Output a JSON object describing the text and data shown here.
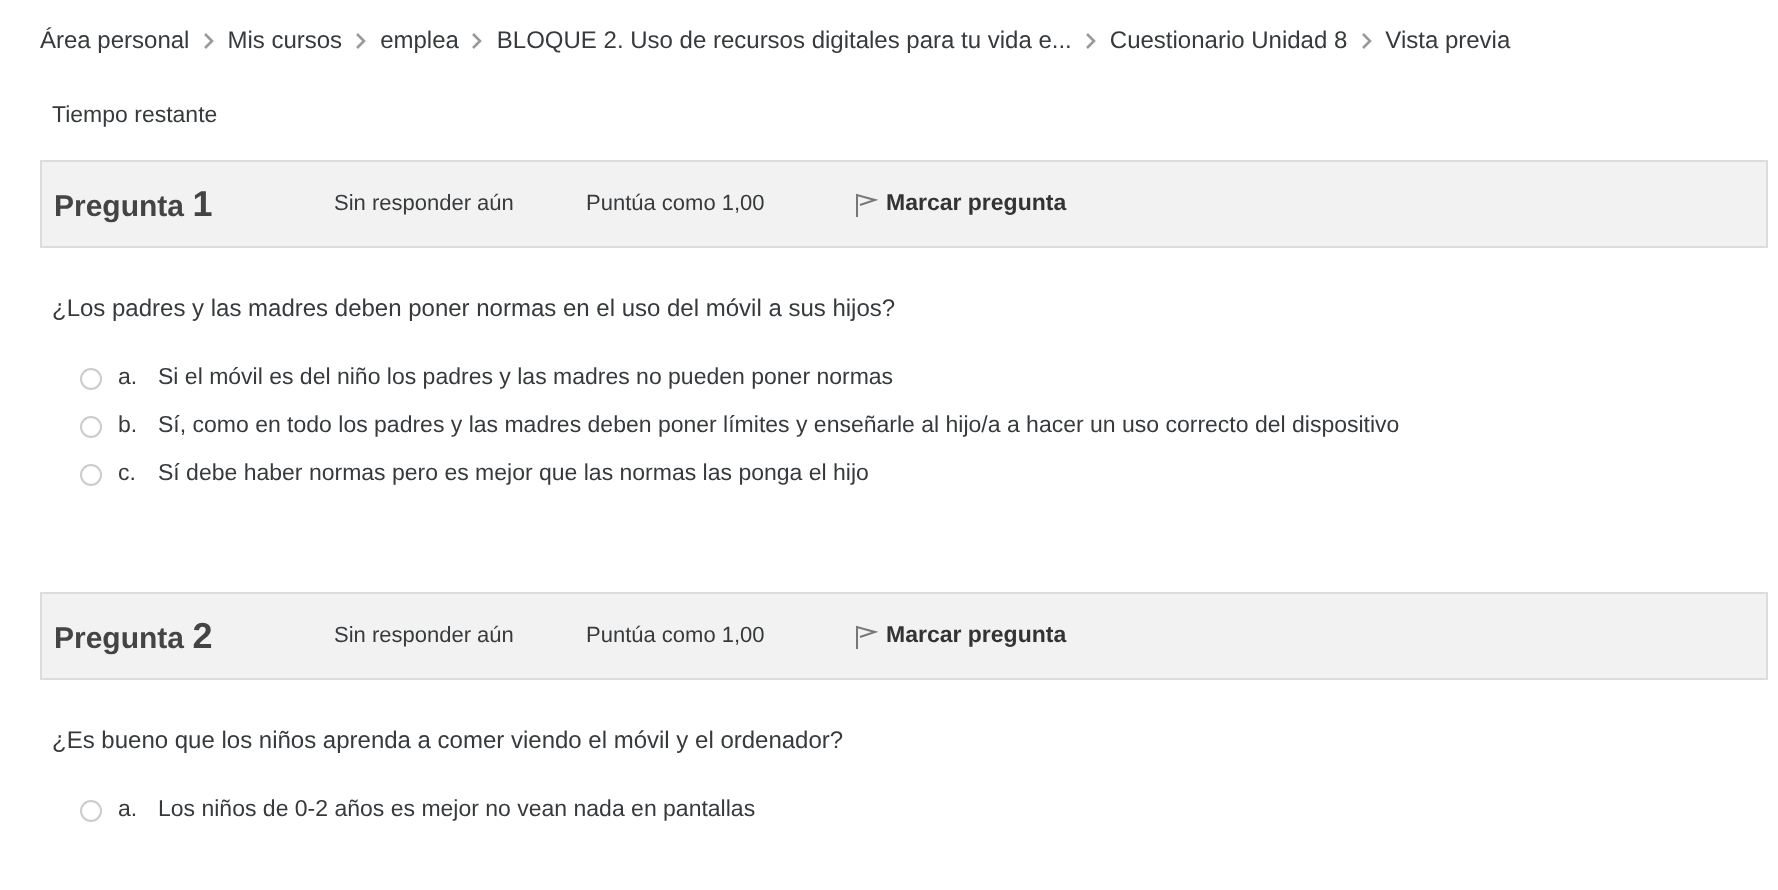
{
  "breadcrumb": [
    "Área personal",
    "Mis cursos",
    "emplea",
    "BLOQUE 2. Uso de recursos digitales para tu vida e...",
    "Cuestionario Unidad 8",
    "Vista previa"
  ],
  "timer_label": "Tiempo restante",
  "questions": [
    {
      "label": "Pregunta",
      "number": "1",
      "status": "Sin responder aún",
      "grade": "Puntúa como 1,00",
      "flag": "Marcar pregunta",
      "flagged": false,
      "text": "¿Los padres y las madres deben poner normas en el uso del móvil a sus hijos?",
      "options": [
        {
          "letter": "a.",
          "text": "Si el móvil es del niño los padres y las madres no pueden poner normas",
          "selected": false
        },
        {
          "letter": "b.",
          "text": "Sí, como en todo los padres y las madres deben poner límites y enseñarle al hijo/a a hacer un uso correcto del dispositivo",
          "selected": false
        },
        {
          "letter": "c.",
          "text": "Sí debe haber normas pero es mejor que las normas las ponga el hijo",
          "selected": false
        }
      ]
    },
    {
      "label": "Pregunta",
      "number": "2",
      "status": "Sin responder aún",
      "grade": "Puntúa como 1,00",
      "flag": "Marcar pregunta",
      "flagged": false,
      "text": "¿Es bueno que los niños aprenda a comer viendo el móvil y el ordenador?",
      "options": [
        {
          "letter": "a.",
          "text": "Los niños de 0-2 años es mejor no vean nada en pantallas",
          "selected": false
        }
      ]
    }
  ]
}
